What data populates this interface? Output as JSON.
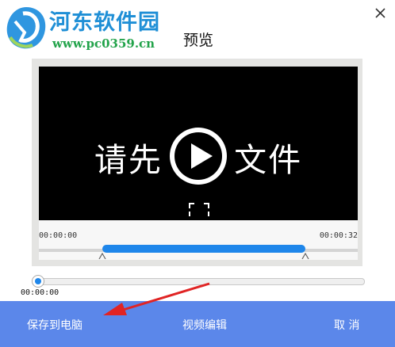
{
  "watermark": {
    "site_name": "河东软件园",
    "url": "www.pc0359.cn"
  },
  "dialog": {
    "title": "预览",
    "close_icon": "close-icon"
  },
  "video": {
    "message": "请先      文件",
    "play_icon": "play-icon"
  },
  "timeline": {
    "start_time": "00:00:00",
    "end_time": "00:00:32",
    "selection_start": 0.17,
    "selection_end": 0.87
  },
  "playback": {
    "current_time": "00:00:00",
    "progress": 0.0
  },
  "footer": {
    "save_label": "保存到电脑",
    "edit_label": "视频编辑",
    "cancel_label": "取 消"
  },
  "colors": {
    "bottom_bar": "#5b87ea",
    "accent": "#1e86ea",
    "annotation_arrow": "#e02424",
    "logo_blue": "#1f8fd6",
    "logo_green": "#22a34a"
  }
}
